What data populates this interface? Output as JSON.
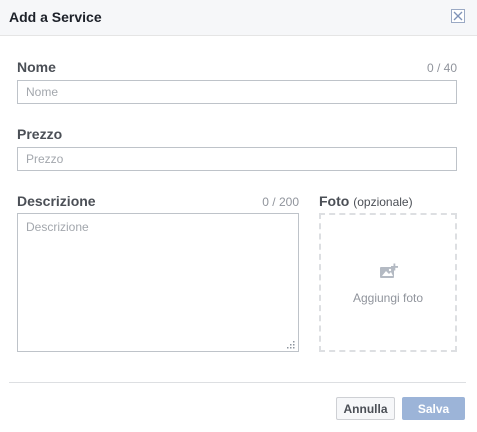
{
  "dialog": {
    "title": "Add a Service"
  },
  "form": {
    "name": {
      "label": "Nome",
      "counter": "0 / 40",
      "placeholder": "Nome",
      "value": ""
    },
    "price": {
      "label": "Prezzo",
      "placeholder": "Prezzo",
      "value": ""
    },
    "description": {
      "label": "Descrizione",
      "counter": "0 / 200",
      "placeholder": "Descrizione",
      "value": ""
    },
    "photo": {
      "label": "Foto",
      "optional": "(opzionale)",
      "add_label": "Aggiungi foto",
      "icon": "add-photo-icon"
    }
  },
  "footer": {
    "cancel_label": "Annulla",
    "save_label": "Salva"
  },
  "colors": {
    "save_disabled": "#9cb4d8",
    "header_bg": "#f6f7f9"
  }
}
